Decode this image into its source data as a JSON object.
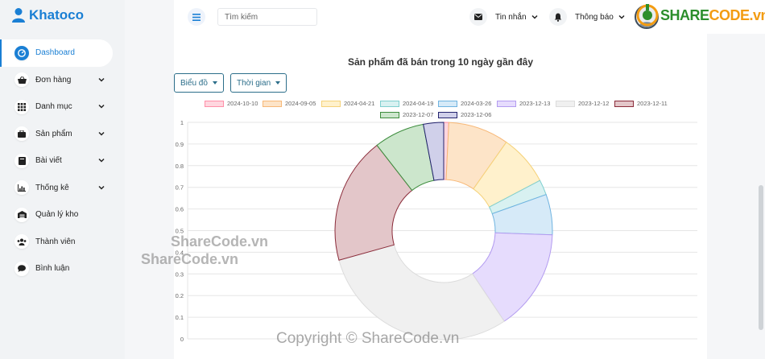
{
  "brand": {
    "name": "Khatoco"
  },
  "sidebar": {
    "items": [
      {
        "label": "Dashboard",
        "icon": "dashboard-icon",
        "active": true,
        "has_chevron": false
      },
      {
        "label": "Đơn hàng",
        "icon": "basket-icon",
        "active": false,
        "has_chevron": true
      },
      {
        "label": "Danh mục",
        "icon": "grid-icon",
        "active": false,
        "has_chevron": true
      },
      {
        "label": "Sản phẩm",
        "icon": "briefcase-icon",
        "active": false,
        "has_chevron": true
      },
      {
        "label": "Bài viết",
        "icon": "book-icon",
        "active": false,
        "has_chevron": true
      },
      {
        "label": "Thống kê",
        "icon": "chart-icon",
        "active": false,
        "has_chevron": true
      },
      {
        "label": "Quản lý kho",
        "icon": "warehouse-icon",
        "active": false,
        "has_chevron": false
      },
      {
        "label": "Thành viên",
        "icon": "users-icon",
        "active": false,
        "has_chevron": false
      },
      {
        "label": "Bình luận",
        "icon": "comment-icon",
        "active": false,
        "has_chevron": false
      }
    ]
  },
  "topbar": {
    "search_placeholder": "Tìm kiếm",
    "messages_label": "Tin nhắn",
    "notifications_label": "Thông báo",
    "logo_text_a": "SHARE",
    "logo_text_b": "CODE.vn"
  },
  "controls": {
    "chart_type_label": "Biểu đồ",
    "time_label": "Thời gian"
  },
  "watermarks": {
    "w1": "ShareCode.vn",
    "w2": "ShareCode.vn",
    "copyright": "Copyright © ShareCode.vn"
  },
  "colors": {
    "accent": "#1a7fd4",
    "button_outline": "#2c6e8a"
  },
  "chart_data": {
    "type": "doughnut",
    "title": "Sản phẩm đã bán trong 10 ngày gần đây",
    "categories": [
      "2024-10-10",
      "2024-09-05",
      "2024-04-21",
      "2024-04-19",
      "2024-03-26",
      "2023-12-13",
      "2023-12-12",
      "2023-12-11",
      "2023-12-07",
      "2023-12-06"
    ],
    "values": [
      1,
      12,
      10,
      3,
      8,
      20,
      40,
      25,
      10,
      4
    ],
    "fill_colors": [
      "#ffd6df",
      "#fde4c8",
      "#fff1cc",
      "#d8f1f1",
      "#d6eaf8",
      "#e6dcfd",
      "#f0f0f0",
      "#e3c6c9",
      "#cce6cc",
      "#d0d0ea"
    ],
    "border_colors": [
      "#ff8fa8",
      "#f7b877",
      "#f5d27a",
      "#7fcfcf",
      "#6fb3e0",
      "#b39cf0",
      "#dcdcdc",
      "#8b2c3a",
      "#3c8c3c",
      "#24246e"
    ],
    "yticks": [
      "1",
      "0.9",
      "0.8",
      "0.7",
      "0.6",
      "0.5",
      "0.4",
      "0.3",
      "0.2",
      "0.1",
      "0"
    ],
    "legend_position": "top",
    "grid": true
  }
}
